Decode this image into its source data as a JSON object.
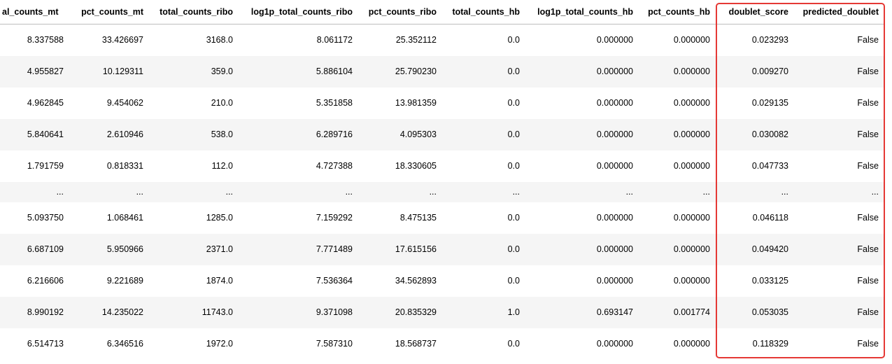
{
  "columns": [
    "al_counts_mt",
    "pct_counts_mt",
    "total_counts_ribo",
    "log1p_total_counts_ribo",
    "pct_counts_ribo",
    "total_counts_hb",
    "log1p_total_counts_hb",
    "pct_counts_hb",
    "doublet_score",
    "predicted_doublet"
  ],
  "rows": [
    [
      "8.337588",
      "33.426697",
      "3168.0",
      "8.061172",
      "25.352112",
      "0.0",
      "0.000000",
      "0.000000",
      "0.023293",
      "False"
    ],
    [
      "4.955827",
      "10.129311",
      "359.0",
      "5.886104",
      "25.790230",
      "0.0",
      "0.000000",
      "0.000000",
      "0.009270",
      "False"
    ],
    [
      "4.962845",
      "9.454062",
      "210.0",
      "5.351858",
      "13.981359",
      "0.0",
      "0.000000",
      "0.000000",
      "0.029135",
      "False"
    ],
    [
      "5.840641",
      "2.610946",
      "538.0",
      "6.289716",
      "4.095303",
      "0.0",
      "0.000000",
      "0.000000",
      "0.030082",
      "False"
    ],
    [
      "1.791759",
      "0.818331",
      "112.0",
      "4.727388",
      "18.330605",
      "0.0",
      "0.000000",
      "0.000000",
      "0.047733",
      "False"
    ],
    [
      "...",
      "...",
      "...",
      "...",
      "...",
      "...",
      "...",
      "...",
      "...",
      "..."
    ],
    [
      "5.093750",
      "1.068461",
      "1285.0",
      "7.159292",
      "8.475135",
      "0.0",
      "0.000000",
      "0.000000",
      "0.046118",
      "False"
    ],
    [
      "6.687109",
      "5.950966",
      "2371.0",
      "7.771489",
      "17.615156",
      "0.0",
      "0.000000",
      "0.000000",
      "0.049420",
      "False"
    ],
    [
      "6.216606",
      "9.221689",
      "1874.0",
      "7.536364",
      "34.562893",
      "0.0",
      "0.000000",
      "0.000000",
      "0.033125",
      "False"
    ],
    [
      "8.990192",
      "14.235022",
      "11743.0",
      "9.371098",
      "20.835329",
      "1.0",
      "0.693147",
      "0.001774",
      "0.053035",
      "False"
    ],
    [
      "6.514713",
      "6.346516",
      "1972.0",
      "7.587310",
      "18.568737",
      "0.0",
      "0.000000",
      "0.000000",
      "0.118329",
      "False"
    ]
  ],
  "highlight": {
    "columns": [
      "doublet_score",
      "predicted_doublet"
    ],
    "color": "#e53935"
  },
  "style": {
    "stripe_color": "#f5f5f5",
    "header_rule_color": "#bdbdbd",
    "text_color": "#000000"
  }
}
